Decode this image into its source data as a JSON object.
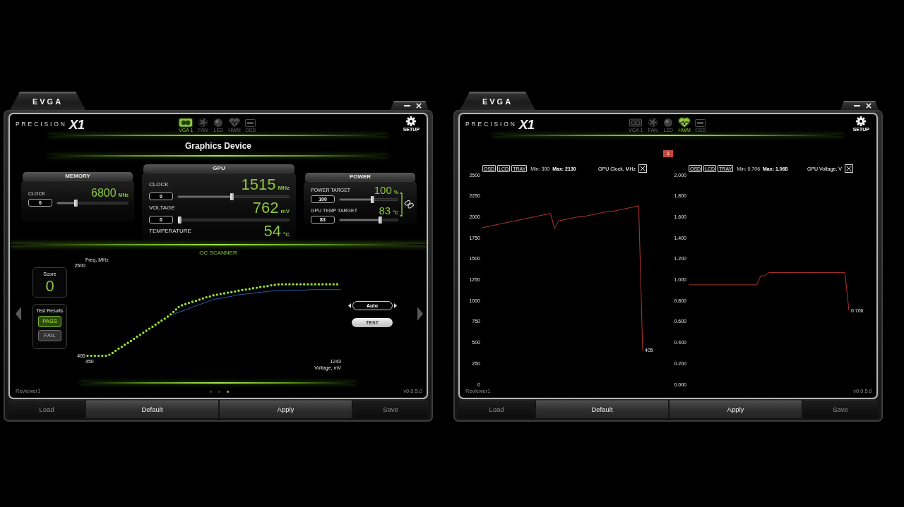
{
  "windows": [
    {
      "kind": "tuning",
      "brand": "EVGA",
      "app_name": {
        "word": "PRECISION",
        "mark": "X1"
      },
      "nav": [
        {
          "kind": "card",
          "label": "VGA 1",
          "selected": true
        },
        {
          "kind": "fan",
          "label": "FAN",
          "selected": false
        },
        {
          "kind": "led",
          "label": "LED",
          "selected": false
        },
        {
          "kind": "heart",
          "label": "HWM",
          "selected": false
        },
        {
          "kind": "screen",
          "label": "OSD",
          "selected": false
        }
      ],
      "setup_label": "SETUP",
      "title": "Graphics Device",
      "panels": [
        {
          "title": "MEMORY",
          "rows": [
            {
              "kind": "slider",
              "label": "CLOCK",
              "value": "6800",
              "unit": "MHz",
              "input": "0",
              "level": 0.25
            }
          ]
        },
        {
          "title": "GPU",
          "rows": [
            {
              "kind": "slider",
              "label": "CLOCK",
              "value": "1515",
              "unit": "MHz",
              "input": "0",
              "level": 0.49
            },
            {
              "kind": "slider",
              "label": "VOLTAGE",
              "value": "762",
              "unit": "mV",
              "input": "0",
              "level": 0
            },
            {
              "kind": "reading",
              "label": "TEMPERATURE",
              "value": "54",
              "unit": "°C"
            }
          ]
        },
        {
          "title": "POWER",
          "linked": true,
          "rows": [
            {
              "kind": "slider",
              "label": "POWER TARGET",
              "value": "100",
              "unit": "%",
              "input": "100",
              "level": 0.57
            },
            {
              "kind": "slider",
              "label": "GPU TEMP TARGET",
              "value": "83",
              "unit": "°C",
              "input": "83",
              "level": 0.72
            }
          ]
        }
      ],
      "oc_scanner": {
        "title": "OC SCANNER",
        "score_label": "Score",
        "score": "0",
        "results_label": "Test Results",
        "results": [
          {
            "kind": "pass",
            "label": "PASS",
            "lit": true
          },
          {
            "kind": "fail",
            "label": "FAIL",
            "lit": false
          }
        ],
        "chart_data": {
          "type": "line",
          "xlabel": "Voltage, mV",
          "ylabel": "Freq, MHz",
          "xlim": [
            450,
            1243
          ],
          "ylim": [
            465,
            2500
          ],
          "xticks": [
            450,
            1243
          ],
          "yticks": [
            465,
            2500
          ],
          "x": [
            450,
            462,
            474,
            486,
            498,
            510,
            522,
            534,
            546,
            558,
            570,
            582,
            594,
            606,
            618,
            630,
            642,
            654,
            666,
            678,
            690,
            702,
            714,
            726,
            738,
            750,
            762,
            774,
            786,
            798,
            810,
            822,
            834,
            846,
            858,
            870,
            882,
            894,
            906,
            918,
            930,
            942,
            954,
            966,
            978,
            990,
            1002,
            1014,
            1026,
            1038,
            1050,
            1062,
            1074,
            1086,
            1098,
            1110,
            1122,
            1134,
            1146,
            1158,
            1170,
            1182,
            1194,
            1206,
            1218,
            1230,
            1242
          ],
          "series": [
            {
              "color": "#9be22d",
              "line_style": "dotted",
              "values": [
                465,
                465,
                465,
                465,
                465,
                465,
                500,
                560,
                620,
                670,
                730,
                780,
                840,
                900,
                950,
                1010,
                1070,
                1120,
                1180,
                1240,
                1290,
                1350,
                1420,
                1500,
                1580,
                1610,
                1640,
                1670,
                1690,
                1720,
                1750,
                1780,
                1800,
                1830,
                1840,
                1860,
                1870,
                1890,
                1900,
                1920,
                1940,
                1950,
                1960,
                1980,
                1990,
                2010,
                2020,
                2030,
                2050,
                2060,
                2070,
                2070,
                2070,
                2070,
                2070,
                2070,
                2070,
                2070,
                2070,
                2070,
                2070,
                2070,
                2070,
                2070,
                2070,
                2070,
                2070
              ]
            },
            {
              "color": "#2b5fae",
              "values": [
                null,
                null,
                null,
                null,
                null,
                null,
                null,
                null,
                null,
                null,
                null,
                null,
                null,
                null,
                null,
                null,
                null,
                null,
                null,
                null,
                null,
                null,
                1390,
                1420,
                1450,
                1480,
                1510,
                1550,
                1580,
                1610,
                1640,
                1670,
                1710,
                1730,
                1750,
                1760,
                1780,
                1790,
                1810,
                1830,
                1840,
                1850,
                1860,
                1870,
                1880,
                1890,
                1900,
                1910,
                1920,
                1930,
                1930,
                1930,
                1940,
                1940,
                1940,
                1940,
                1940,
                1940,
                1950,
                1950,
                1950,
                1950,
                1950,
                1950,
                1950,
                1950,
                1950
              ]
            }
          ]
        },
        "mode": "Auto",
        "test_button": "TEST"
      },
      "footer": {
        "user": "Reviewer1",
        "pages": [
          {
            "selected": false
          },
          {
            "selected": false
          },
          {
            "selected": true
          }
        ],
        "version": "v0.0.5.0"
      },
      "buttons": [
        {
          "label": "Load",
          "disabled": true
        },
        {
          "label": "Default",
          "disabled": false
        },
        {
          "label": "Apply",
          "disabled": false
        },
        {
          "label": "Save",
          "disabled": true
        }
      ]
    },
    {
      "kind": "monitor",
      "brand": "EVGA",
      "app_name": {
        "word": "PRECISION",
        "mark": "X1"
      },
      "nav": [
        {
          "kind": "card",
          "label": "VGA 1",
          "selected": false
        },
        {
          "kind": "fan",
          "label": "FAN",
          "selected": false
        },
        {
          "kind": "led",
          "label": "LED",
          "selected": false
        },
        {
          "kind": "heart",
          "label": "HWM",
          "selected": true
        },
        {
          "kind": "screen",
          "label": "OSD",
          "selected": false
        }
      ],
      "setup_label": "SETUP",
      "page_badge": "1",
      "graphs": [
        {
          "toggles": [
            "OSD",
            "LCD",
            "TRAY"
          ],
          "min": "Min: 300",
          "max": "Max: 2130",
          "current_value": "405",
          "chart_data": {
            "type": "line",
            "title": "GPU Clock, MHz",
            "ylim": [
              0,
              2500
            ],
            "yticks": [
              0,
              250,
              500,
              750,
              1000,
              1250,
              1500,
              1750,
              2000,
              2250,
              2500
            ],
            "series": [
              {
                "color": "#b5362c",
                "values": [
                  1870,
                  1880,
                  1890,
                  1900,
                  1910,
                  1920,
                  1930,
                  1940,
                  1950,
                  1960,
                  1970,
                  1980,
                  1990,
                  2000,
                  2010,
                  2020,
                  2030,
                  2040,
                  1860,
                  1950,
                  1960,
                  1970,
                  1980,
                  1990,
                  2000,
                  2000,
                  2010,
                  2020,
                  2030,
                  2040,
                  2050,
                  2060,
                  2060,
                  2070,
                  2080,
                  2090,
                  2100,
                  2110,
                  2120,
                  2130,
                  405
                ]
              }
            ]
          }
        },
        {
          "toggles": [
            "OSD",
            "LCD",
            "TRAY"
          ],
          "min": "Min: 0.706",
          "max": "Max: 1.068",
          "current_value": "0.706",
          "chart_data": {
            "type": "line",
            "title": "GPU Voltage, V",
            "ylim": [
              0,
              2
            ],
            "yticks": [
              {
                "value": 0,
                "label": "0.000"
              },
              {
                "value": 0.2,
                "label": "0.200"
              },
              {
                "value": 0.4,
                "label": "0.400"
              },
              {
                "value": 0.6,
                "label": "0.600"
              },
              {
                "value": 0.8,
                "label": "0.800"
              },
              {
                "value": 1,
                "label": "1.000"
              },
              {
                "value": 1.2,
                "label": "1.200"
              },
              {
                "value": 1.4,
                "label": "1.400"
              },
              {
                "value": 1.6,
                "label": "1.600"
              },
              {
                "value": 1.8,
                "label": "1.800"
              },
              {
                "value": 2,
                "label": "2.000"
              }
            ],
            "series": [
              {
                "color": "#b5362c",
                "values": [
                  0.95,
                  0.95,
                  0.95,
                  0.95,
                  0.95,
                  0.95,
                  0.95,
                  0.95,
                  0.95,
                  0.95,
                  0.95,
                  0.95,
                  0.95,
                  0.95,
                  0.95,
                  0.95,
                  0.95,
                  0.95,
                  1.036,
                  1.036,
                  1.068,
                  1.068,
                  1.068,
                  1.068,
                  1.068,
                  1.068,
                  1.068,
                  1.068,
                  1.068,
                  1.068,
                  1.068,
                  1.068,
                  1.068,
                  1.068,
                  1.068,
                  1.068,
                  1.068,
                  1.068,
                  1.068,
                  1.068,
                  0.706
                ]
              }
            ]
          }
        }
      ],
      "footer": {
        "user": "Reviewer1",
        "version": "v0.0.5.0"
      },
      "buttons": [
        {
          "label": "Load",
          "disabled": true
        },
        {
          "label": "Default",
          "disabled": false
        },
        {
          "label": "Apply",
          "disabled": false
        },
        {
          "label": "Save",
          "disabled": true
        }
      ]
    }
  ]
}
